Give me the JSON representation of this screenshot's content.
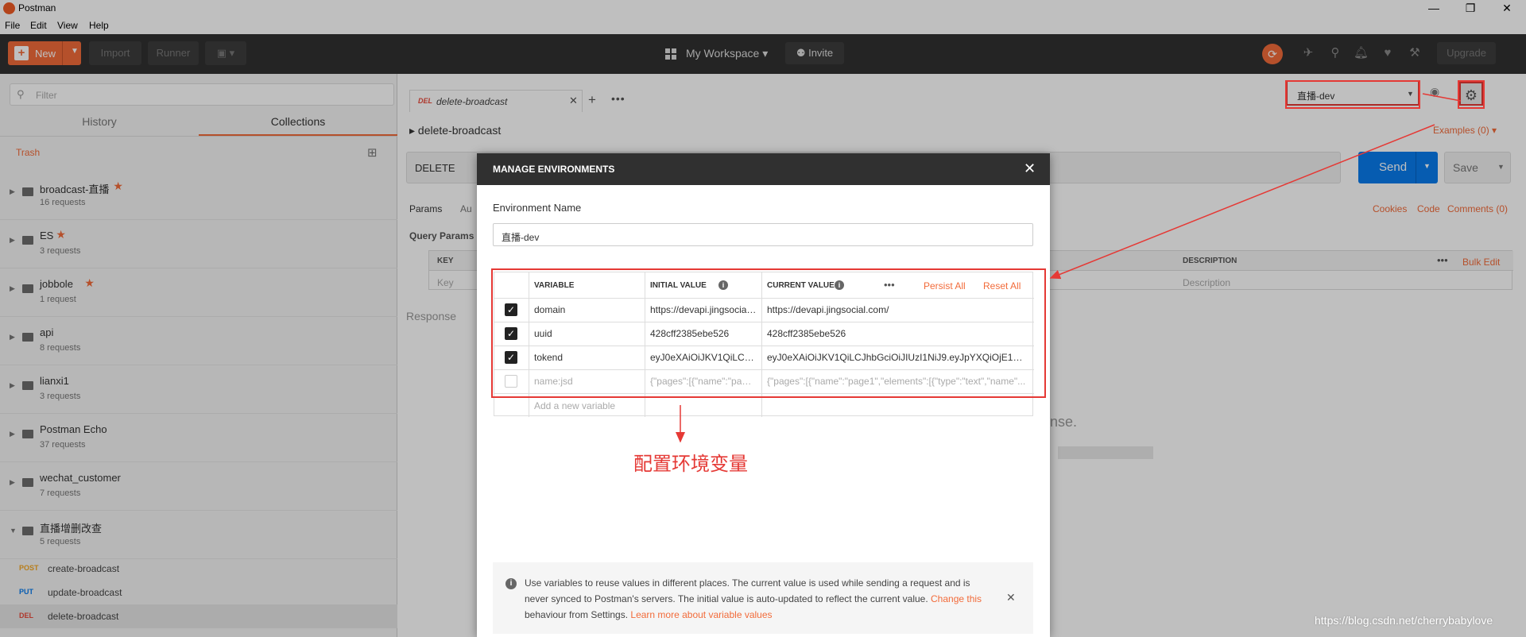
{
  "window": {
    "title": "Postman",
    "minimize": "—",
    "maximize": "❐",
    "close": "✕"
  },
  "menu": [
    "File",
    "Edit",
    "View",
    "Help"
  ],
  "toolbar": {
    "new_label": "New",
    "import_label": "Import",
    "runner_label": "Runner",
    "workspace_label": "My Workspace",
    "invite_label": "Invite",
    "upgrade_label": "Upgrade"
  },
  "sidebar": {
    "filter_placeholder": "Filter",
    "tabs": [
      "History",
      "Collections"
    ],
    "trash_label": "Trash",
    "collections": [
      {
        "name": "broadcast-直播",
        "count": "16 requests",
        "starred": true
      },
      {
        "name": "ES",
        "count": "3 requests",
        "starred": true
      },
      {
        "name": "jobbole",
        "count": "1 request",
        "starred": true
      },
      {
        "name": "api",
        "count": "8 requests",
        "starred": false
      },
      {
        "name": "lianxi1",
        "count": "3 requests",
        "starred": false
      },
      {
        "name": "Postman Echo",
        "count": "37 requests",
        "starred": false
      },
      {
        "name": "wechat_customer",
        "count": "7 requests",
        "starred": false
      },
      {
        "name": "直播增删改查",
        "count": "5 requests",
        "starred": false
      }
    ],
    "requests": [
      {
        "method": "POST",
        "name": "create-broadcast",
        "color": "#f4a825"
      },
      {
        "method": "PUT",
        "name": "update-broadcast",
        "color": "#097bed"
      },
      {
        "method": "DEL",
        "name": "delete-broadcast",
        "color": "#e84b3d"
      }
    ]
  },
  "main": {
    "tab": {
      "method": "DEL",
      "name": "delete-broadcast"
    },
    "env_selected": "直播-dev",
    "breadcrumb": "delete-broadcast",
    "examples": "Examples (0)",
    "method": "DELETE",
    "send_label": "Send",
    "save_label": "Save",
    "subtabs": [
      "Params",
      "Au"
    ],
    "links": [
      "Cookies",
      "Code",
      "Comments (0)"
    ],
    "query_params": "Query Params",
    "params_table": {
      "key": "KEY",
      "key_ph": "Key",
      "description": "DESCRIPTION",
      "desc_ph": "Description",
      "bulk_edit": "Bulk Edit"
    },
    "response_label": "Response",
    "response_msg": "onse."
  },
  "modal": {
    "title": "MANAGE ENVIRONMENTS",
    "env_name_label": "Environment Name",
    "env_name_value": "直播-dev",
    "columns": {
      "variable": "VARIABLE",
      "initial": "INITIAL VALUE",
      "current": "CURRENT VALUE"
    },
    "persist_all": "Persist All",
    "reset_all": "Reset All",
    "rows": [
      {
        "checked": true,
        "variable": "domain",
        "initial": "https://devapi.jingsocial.com/",
        "current": "https://devapi.jingsocial.com/"
      },
      {
        "checked": true,
        "variable": "uuid",
        "initial": "428cff2385ebe526",
        "current": "428cff2385ebe526"
      },
      {
        "checked": true,
        "variable": "tokend",
        "initial": "eyJ0eXAiOiJKV1QiLCJhbGciOiJIUzI1NiJ9",
        "current": "eyJ0eXAiOiJKV1QiLCJhbGciOiJIUzI1NiJ9.eyJpYXQiOjE1NTI0..."
      },
      {
        "checked": false,
        "variable": "name:jsd",
        "initial": "{\"pages\":[{\"name\":\"page1\"",
        "current": "{\"pages\":[{\"name\":\"page1\",\"elements\":[{\"type\":\"text\",\"name\"..."
      }
    ],
    "add_placeholder": "Add a new variable",
    "tip": {
      "text1": "Use variables to reuse values in different places. The current value is used while sending a request and is never synced to Postman's servers. The initial value is auto-updated to reflect the current value. ",
      "link1": "Change this",
      "text2": " behaviour from Settings. ",
      "link2": "Learn more about variable values"
    }
  },
  "annotation": "配置环境变量",
  "watermark": "https://blog.csdn.net/cherrybabylove",
  "colors": {
    "accent": "#f26b3a",
    "highlight": "#e53935",
    "send": "#097bed",
    "toolbar": "#303030"
  }
}
